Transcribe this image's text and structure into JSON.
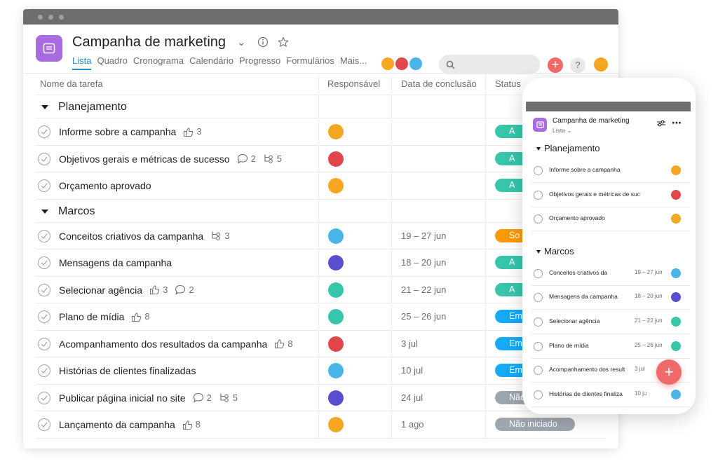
{
  "app": {
    "title": "Campanha de marketing",
    "tabs": [
      {
        "label": "Lista",
        "active": true
      },
      {
        "label": "Quadro"
      },
      {
        "label": "Cronograma"
      },
      {
        "label": "Calendário"
      },
      {
        "label": "Progresso"
      },
      {
        "label": "Formulários"
      },
      {
        "label": "Mais..."
      }
    ],
    "plus_label": "+",
    "help_label": "?"
  },
  "columns": {
    "task": "Nome da tarefa",
    "assignee": "Responsável",
    "due": "Data de conclusão",
    "status": "Status"
  },
  "sections": [
    {
      "name": "Planejamento",
      "tasks": [
        {
          "name": "Informe sobre a campanha",
          "likes": "3",
          "avatar_color": "#f5a623",
          "date": "",
          "status": "A",
          "status_color": "#37c5ab"
        },
        {
          "name": "Objetivos gerais e métricas de sucesso",
          "comments": "2",
          "subtasks": "5",
          "avatar_color": "#e0474c",
          "date": "",
          "status": "A",
          "status_color": "#37c5ab"
        },
        {
          "name": "Orçamento aprovado",
          "avatar_color": "#f5a623",
          "date": "",
          "status": "A",
          "status_color": "#37c5ab"
        }
      ]
    },
    {
      "name": "Marcos",
      "tasks": [
        {
          "name": "Conceitos criativos da campanha",
          "subtasks": "3",
          "avatar_color": "#4ab4e6",
          "date": "19 – 27 jun",
          "status": "So",
          "status_color": "#fd9a00"
        },
        {
          "name": "Mensagens da campanha",
          "avatar_color": "#5a4fcf",
          "date": "18 – 20 jun",
          "status": "A",
          "status_color": "#37c5ab"
        },
        {
          "name": "Selecionar agência",
          "likes": "3",
          "comments": "2",
          "avatar_color": "#37c5ab",
          "date": "21 – 22 jun",
          "status": "A",
          "status_color": "#37c5ab"
        },
        {
          "name": "Plano de mídia",
          "likes": "8",
          "avatar_color": "#37c5ab",
          "date": "25 – 26 jun",
          "status": "Em a",
          "status_color": "#14aaf5"
        },
        {
          "name": "Acompanhamento dos resultados da campanha",
          "likes": "8",
          "avatar_color": "#e0474c",
          "date": "3 jul",
          "status": "Em a",
          "status_color": "#14aaf5"
        },
        {
          "name": "Histórias de clientes finalizadas",
          "avatar_color": "#4ab4e6",
          "date": "10 jul",
          "status": "Em a",
          "status_color": "#14aaf5"
        },
        {
          "name": "Publicar página inicial no site",
          "comments": "2",
          "subtasks": "5",
          "avatar_color": "#5a4fcf",
          "date": "24 jul",
          "status": "Não",
          "status_color": "#9ca6af"
        },
        {
          "name": "Lançamento da campanha",
          "likes": "8",
          "avatar_color": "#f5a623",
          "date": "1 ago",
          "status": "Não iniciado",
          "status_color": "#9ca6af"
        }
      ]
    }
  ],
  "mobile": {
    "title": "Campanha de marketing",
    "view": "Lista",
    "sections": [
      {
        "name": "Planejamento",
        "tasks": [
          {
            "name": "Informe sobre a campanha",
            "date": "",
            "avatar_color": "#f5a623"
          },
          {
            "name": "Objetivos gerais e métricas de suc",
            "date": "",
            "avatar_color": "#e0474c"
          },
          {
            "name": "Orçamento aprovado",
            "date": "",
            "avatar_color": "#f5a623"
          }
        ]
      },
      {
        "name": "Marcos",
        "tasks": [
          {
            "name": "Conceitos criativos da",
            "date": "19 – 27 jun",
            "avatar_color": "#4ab4e6"
          },
          {
            "name": "Mensagens da campanha",
            "date": "18 – 20 jun",
            "avatar_color": "#5a4fcf"
          },
          {
            "name": "Selecionar agência",
            "date": "21 – 22 jun",
            "avatar_color": "#37c5ab"
          },
          {
            "name": "Plano de mídia",
            "date": "25 – 26 jun",
            "avatar_color": "#37c5ab"
          },
          {
            "name": "Acompanhamento dos result",
            "date": "3 jul",
            "avatar_color": "#e0474c"
          },
          {
            "name": "Histórias de clientes finaliza",
            "date": "10 ju",
            "avatar_color": "#4ab4e6"
          }
        ]
      }
    ]
  },
  "colors": {
    "accent": "#208cca",
    "project": "#a96be0",
    "coral": "#f06a6a"
  }
}
